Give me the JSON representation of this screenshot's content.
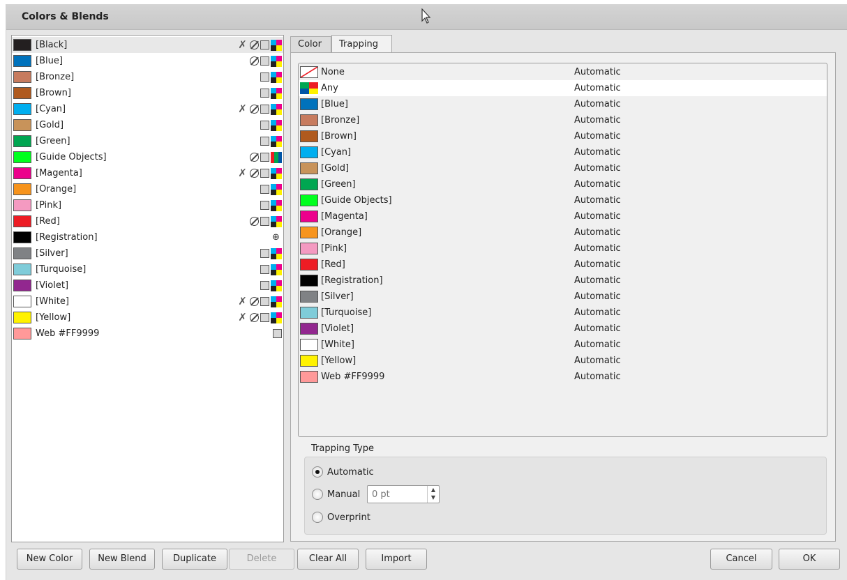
{
  "window": {
    "title": "Colors & Blends"
  },
  "colors": [
    {
      "name": "[Black]",
      "color": "#231f20",
      "icons": [
        "no-trap",
        "no-print",
        "spot",
        "cmyk"
      ],
      "selected": true
    },
    {
      "name": "[Blue]",
      "color": "#0072bc",
      "icons": [
        "no-print",
        "spot",
        "cmyk"
      ]
    },
    {
      "name": "[Bronze]",
      "color": "#c77b5e",
      "icons": [
        "spot",
        "cmyk"
      ]
    },
    {
      "name": "[Brown]",
      "color": "#b05a1e",
      "icons": [
        "spot",
        "cmyk"
      ]
    },
    {
      "name": "[Cyan]",
      "color": "#00aeef",
      "icons": [
        "no-trap",
        "no-print",
        "spot",
        "cmyk"
      ]
    },
    {
      "name": "[Gold]",
      "color": "#c8935a",
      "icons": [
        "spot",
        "cmyk"
      ]
    },
    {
      "name": "[Green]",
      "color": "#00a651",
      "icons": [
        "spot",
        "cmyk"
      ]
    },
    {
      "name": "[Guide Objects]",
      "color": "#00ff1e",
      "icons": [
        "no-print",
        "spot",
        "rgb"
      ]
    },
    {
      "name": "[Magenta]",
      "color": "#ec008c",
      "icons": [
        "no-trap",
        "no-print",
        "spot",
        "cmyk"
      ]
    },
    {
      "name": "[Orange]",
      "color": "#f7941d",
      "icons": [
        "spot",
        "cmyk"
      ]
    },
    {
      "name": "[Pink]",
      "color": "#f49ac1",
      "icons": [
        "spot",
        "cmyk"
      ]
    },
    {
      "name": "[Red]",
      "color": "#ed1c24",
      "icons": [
        "no-print",
        "spot",
        "cmyk"
      ]
    },
    {
      "name": "[Registration]",
      "color": "#000000",
      "icons": [
        "registration"
      ]
    },
    {
      "name": "[Silver]",
      "color": "#808285",
      "icons": [
        "spot",
        "cmyk"
      ]
    },
    {
      "name": "[Turquoise]",
      "color": "#7fccd9",
      "icons": [
        "spot",
        "cmyk"
      ]
    },
    {
      "name": "[Violet]",
      "color": "#92278f",
      "icons": [
        "spot",
        "cmyk"
      ]
    },
    {
      "name": "[White]",
      "color": "#ffffff",
      "icons": [
        "no-trap",
        "no-print",
        "spot",
        "cmyk"
      ]
    },
    {
      "name": "[Yellow]",
      "color": "#fff200",
      "icons": [
        "no-trap",
        "no-print",
        "spot",
        "cmyk"
      ]
    },
    {
      "name": "Web #FF9999",
      "color": "#ff9999",
      "icons": [
        "spot"
      ]
    }
  ],
  "tabs": [
    {
      "label": "Color",
      "active": false
    },
    {
      "label": "Trapping",
      "active": true
    }
  ],
  "trapping": {
    "rows": [
      {
        "name": "None",
        "swatch": "none",
        "value": "Automatic"
      },
      {
        "name": "Any",
        "swatch": "any",
        "value": "Automatic",
        "selected": true
      },
      {
        "name": "[Blue]",
        "swatch": "#0072bc",
        "value": "Automatic"
      },
      {
        "name": "[Bronze]",
        "swatch": "#c77b5e",
        "value": "Automatic"
      },
      {
        "name": "[Brown]",
        "swatch": "#b05a1e",
        "value": "Automatic"
      },
      {
        "name": "[Cyan]",
        "swatch": "#00aeef",
        "value": "Automatic"
      },
      {
        "name": "[Gold]",
        "swatch": "#c8935a",
        "value": "Automatic"
      },
      {
        "name": "[Green]",
        "swatch": "#00a651",
        "value": "Automatic"
      },
      {
        "name": "[Guide Objects]",
        "swatch": "#00ff1e",
        "value": "Automatic"
      },
      {
        "name": "[Magenta]",
        "swatch": "#ec008c",
        "value": "Automatic"
      },
      {
        "name": "[Orange]",
        "swatch": "#f7941d",
        "value": "Automatic"
      },
      {
        "name": "[Pink]",
        "swatch": "#f49ac1",
        "value": "Automatic"
      },
      {
        "name": "[Red]",
        "swatch": "#ed1c24",
        "value": "Automatic"
      },
      {
        "name": "[Registration]",
        "swatch": "#000000",
        "value": "Automatic"
      },
      {
        "name": "[Silver]",
        "swatch": "#808285",
        "value": "Automatic"
      },
      {
        "name": "[Turquoise]",
        "swatch": "#7fccd9",
        "value": "Automatic"
      },
      {
        "name": "[Violet]",
        "swatch": "#92278f",
        "value": "Automatic"
      },
      {
        "name": "[White]",
        "swatch": "#ffffff",
        "value": "Automatic"
      },
      {
        "name": "[Yellow]",
        "swatch": "#fff200",
        "value": "Automatic"
      },
      {
        "name": "Web #FF9999",
        "swatch": "#ff9999",
        "value": "Automatic"
      }
    ],
    "type_label": "Trapping Type",
    "options": {
      "automatic": "Automatic",
      "manual": "Manual",
      "overprint": "Overprint"
    },
    "selected_option": "Automatic",
    "manual_value": "0 pt"
  },
  "buttons": {
    "new_color": "New Color",
    "new_blend": "New Blend",
    "duplicate": "Duplicate",
    "delete": "Delete",
    "clear_all": "Clear All",
    "import": "Import",
    "cancel": "Cancel",
    "ok": "OK"
  }
}
